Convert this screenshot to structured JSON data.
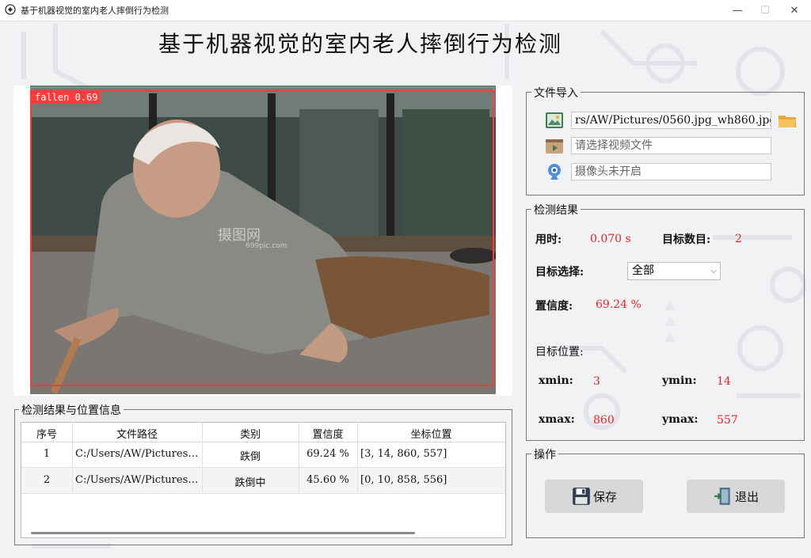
{
  "window": {
    "title": "基于机器视觉的室内老人摔倒行为检测",
    "controls": {
      "minimize": "—",
      "maximize": "☐",
      "close": "✕"
    }
  },
  "page_title": "基于机器视觉的室内老人摔倒行为检测",
  "image_view": {
    "detection_label": "fallen  0.69",
    "watermark": "摄图网",
    "watermark_sub": "699pic.com"
  },
  "file_import": {
    "title": "文件导入",
    "image_path": "rs/AW/Pictures/0560.jpg_wh860.jpg",
    "video_placeholder": "请选择视频文件",
    "camera_placeholder": "摄像头未开启"
  },
  "results": {
    "title": "检测结果",
    "time_label": "用时:",
    "time_value": "0.070 s",
    "count_label": "目标数目:",
    "count_value": "2",
    "target_select_label": "目标选择:",
    "target_select_value": "全部",
    "confidence_label": "置信度:",
    "confidence_value": "69.24 %",
    "position_label": "目标位置:",
    "xmin_label": "xmin:",
    "xmin_value": "3",
    "ymin_label": "ymin:",
    "ymin_value": "14",
    "xmax_label": "xmax:",
    "xmax_value": "860",
    "ymax_label": "ymax:",
    "ymax_value": "557"
  },
  "operations": {
    "title": "操作",
    "save_label": "保存",
    "exit_label": "退出"
  },
  "table": {
    "title": "检测结果与位置信息",
    "headers": [
      "序号",
      "文件路径",
      "类别",
      "置信度",
      "坐标位置"
    ],
    "rows": [
      [
        "1",
        "C:/Users/AW/Pictures…",
        "跌倒",
        "69.24 %",
        "[3, 14, 860, 557]"
      ],
      [
        "2",
        "C:/Users/AW/Pictures…",
        "跌倒中",
        "45.60 %",
        "[0, 10, 858, 556]"
      ]
    ]
  },
  "colors": {
    "accent_red": "#e22222",
    "box_red": "#ff3b3b",
    "button_gray": "#d7d7d7"
  },
  "icons": {
    "image_file": "image-icon",
    "folder": "folder-icon",
    "video": "video-icon",
    "camera": "camera-icon",
    "save": "floppy-disk-icon",
    "exit": "exit-door-icon"
  }
}
